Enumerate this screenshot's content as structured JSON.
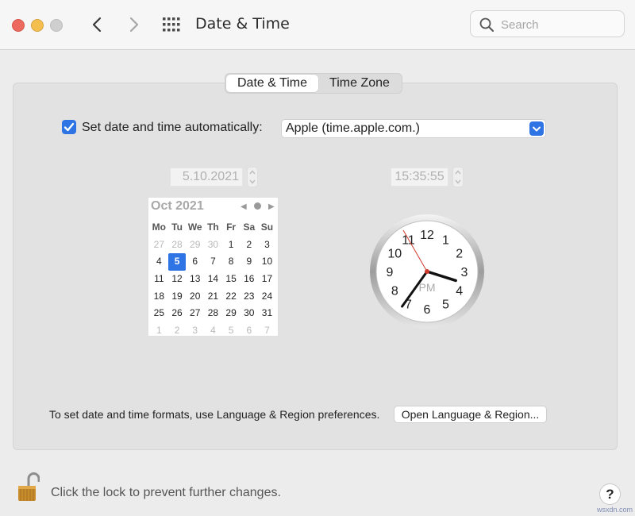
{
  "window": {
    "title": "Date & Time",
    "search_placeholder": "Search"
  },
  "tabs": [
    {
      "label": "Date & Time",
      "active": true
    },
    {
      "label": "Time Zone",
      "active": false
    }
  ],
  "auto_time": {
    "checked": true,
    "label": "Set date and time automatically:",
    "server": "Apple (time.apple.com.)"
  },
  "date_field": "5.10.2021",
  "time_field": "15:35:55",
  "calendar": {
    "month_label": "Oct 2021",
    "weekdays": [
      "Mo",
      "Tu",
      "We",
      "Th",
      "Fr",
      "Sa",
      "Su"
    ],
    "weeks": [
      [
        "27",
        "28",
        "29",
        "30",
        "1",
        "2",
        "3"
      ],
      [
        "4",
        "5",
        "6",
        "7",
        "8",
        "9",
        "10"
      ],
      [
        "11",
        "12",
        "13",
        "14",
        "15",
        "16",
        "17"
      ],
      [
        "18",
        "19",
        "20",
        "21",
        "22",
        "23",
        "24"
      ],
      [
        "25",
        "26",
        "27",
        "28",
        "29",
        "30",
        "31"
      ],
      [
        "1",
        "2",
        "3",
        "4",
        "5",
        "6",
        "7"
      ]
    ],
    "selected_day": "5"
  },
  "clock": {
    "numbers": [
      "12",
      "1",
      "2",
      "3",
      "4",
      "5",
      "6",
      "7",
      "8",
      "9",
      "10",
      "11"
    ],
    "period": "PM",
    "time": "15:35:55"
  },
  "language": {
    "text": "To set date and time formats, use Language & Region preferences.",
    "button": "Open Language & Region..."
  },
  "lock": {
    "text": "Click the lock to prevent further changes."
  },
  "help_label": "?",
  "watermark": "wsxdn.com",
  "colors": {
    "accent": "#2f74e4",
    "close": "#ed6a5e",
    "minimize": "#f5bf4f",
    "maximize_disabled": "#cfcfcf",
    "second_hand": "#d03a2e"
  }
}
